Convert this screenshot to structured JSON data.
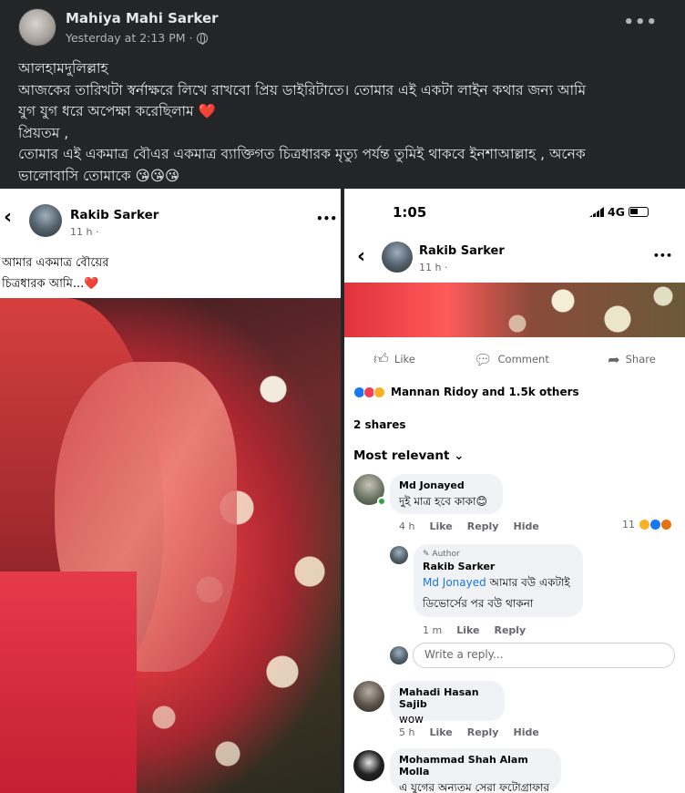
{
  "post": {
    "author": "Mahiya Mahi Sarker",
    "timestamp": "Yesterday at 2:13 PM",
    "privacy_sep": "·",
    "more": "•••",
    "lines": [
      "আলহামদুলিল্লাহ",
      "আজকের তারিখটা স্বর্নাক্ষরে লিখে রাখবো প্রিয় ডাইরিটাতে। তোমার এই একটা লাইন কথার জন্য আমি",
      "যুগ যুগ ধরে অপেক্ষা করেছিলাম ❤️",
      "প্রিয়তম ,",
      "তোমার এই একমাত্র বৌএর একমাত্র ব্যাক্তিগত চিত্রধারক মৃত্যু পর্যন্ত তুমিই থাকবে ইনশাআল্লাহ , অনেক",
      "ভালোবাসি তোমাকে 😘😘😘"
    ]
  },
  "left_shot": {
    "back": "‹",
    "author": "Rakib Sarker",
    "meta": "11 h ·",
    "more": "•••",
    "caption_line1": "আমার একমাত্র বৌয়ের",
    "caption_line2": "চিত্রধারক আমি...❤️"
  },
  "right_shot": {
    "status_time": "1:05",
    "network": "4G",
    "back": "‹",
    "author": "Rakib Sarker",
    "meta": "11 h ·",
    "more": "•••",
    "actions": {
      "like": "Like",
      "comment": "Comment",
      "share": "Share"
    },
    "reactions_text": "Mannan Ridoy and 1.5k others",
    "shares": "2 shares",
    "most_relevant": "Most relevant ⌄",
    "comments": [
      {
        "name": "Md Jonayed",
        "text": "দুই মাত্র হবে কাকা😊",
        "time": "4 h",
        "like": "Like",
        "reply": "Reply",
        "hide": "Hide",
        "react_count": "11"
      },
      {
        "badge": "Author",
        "name": "Rakib Sarker",
        "mention": "Md Jonayed",
        "text1": " আমার বউ একটাই",
        "text2": "ডিভোর্সের পর বউ থাকনা",
        "time": "1 m",
        "like": "Like",
        "reply": "Reply"
      },
      {
        "name": "Mahadi Hasan Sajib",
        "text": "wow",
        "time": "5 h",
        "like": "Like",
        "reply": "Reply",
        "hide": "Hide"
      },
      {
        "name": "Mohammad Shah Alam Molla",
        "text": "এ যুগের অন্যতম সেরা ফটোগ্রাফার"
      }
    ],
    "reply_placeholder": "Write a reply..."
  }
}
